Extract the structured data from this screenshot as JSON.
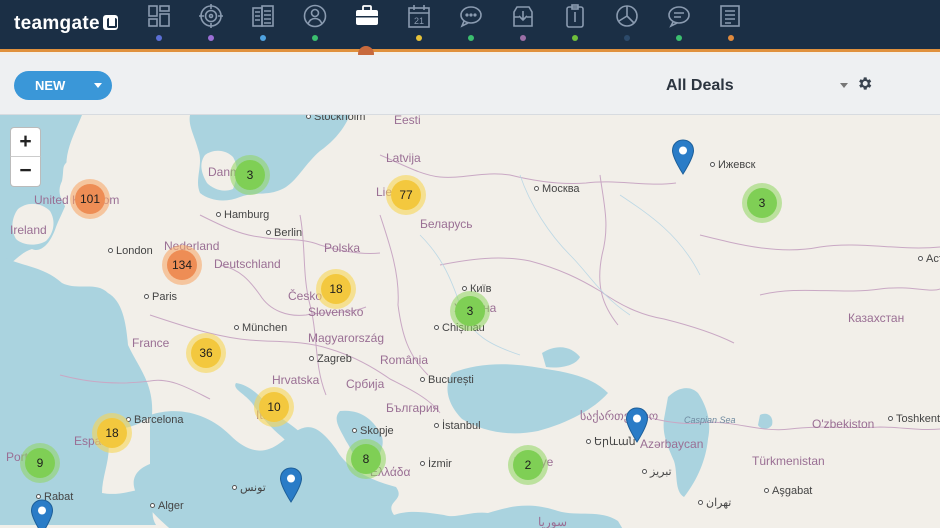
{
  "app": {
    "logo_text": "teamgate"
  },
  "nav": {
    "items": [
      {
        "name": "dashboard",
        "icon": "dashboard-icon",
        "color": "#5b6fd6"
      },
      {
        "name": "goals",
        "icon": "target-icon",
        "color": "#9b6fd6"
      },
      {
        "name": "companies",
        "icon": "companies-icon",
        "color": "#4fa3e0"
      },
      {
        "name": "people",
        "icon": "people-icon",
        "color": "#3bbf6f"
      },
      {
        "name": "deals",
        "icon": "briefcase-icon",
        "color": "#c86a3d",
        "active": true
      },
      {
        "name": "calendar",
        "icon": "calendar-icon",
        "color": "#e6c23a",
        "day": "21"
      },
      {
        "name": "calls",
        "icon": "chat-icon",
        "color": "#3bbf6f"
      },
      {
        "name": "inbox",
        "icon": "inbox-icon",
        "color": "#9b6fa6"
      },
      {
        "name": "notes",
        "icon": "clipboard-icon",
        "color": "#6fbf3b"
      },
      {
        "name": "reports",
        "icon": "pie-chart-icon",
        "color": "#2c4a6a"
      },
      {
        "name": "messages",
        "icon": "message-icon",
        "color": "#3bbf6f"
      },
      {
        "name": "documents",
        "icon": "document-icon",
        "color": "#e08a3d"
      }
    ]
  },
  "toolbar": {
    "new_label": "NEW",
    "view_label": "All Deals"
  },
  "map": {
    "zoom_in": "+",
    "zoom_out": "−",
    "labels": [
      {
        "text": "Stockholm",
        "kind": "city"
      },
      {
        "text": "Eesti",
        "kind": "country"
      },
      {
        "text": "Latvija",
        "kind": "country"
      },
      {
        "text": "Ижевск",
        "kind": "city"
      },
      {
        "text": "Москва",
        "kind": "city"
      },
      {
        "text": "Lietuva",
        "kind": "country"
      },
      {
        "text": "United Kingdom",
        "kind": "country"
      },
      {
        "text": "Ireland",
        "kind": "country"
      },
      {
        "text": "Hamburg",
        "kind": "city"
      },
      {
        "text": "Danmark",
        "kind": "country"
      },
      {
        "text": "Berlin",
        "kind": "city"
      },
      {
        "text": "Беларусь",
        "kind": "country"
      },
      {
        "text": "London",
        "kind": "city"
      },
      {
        "text": "Nederland",
        "kind": "country"
      },
      {
        "text": "Deutschland",
        "kind": "country"
      },
      {
        "text": "Polska",
        "kind": "country"
      },
      {
        "text": "Paris",
        "kind": "city"
      },
      {
        "text": "Česko",
        "kind": "country"
      },
      {
        "text": "Київ",
        "kind": "city"
      },
      {
        "text": "Україна",
        "kind": "country"
      },
      {
        "text": "Slovensko",
        "kind": "country"
      },
      {
        "text": "München",
        "kind": "city"
      },
      {
        "text": "Magyarország",
        "kind": "country"
      },
      {
        "text": "Chișinău",
        "kind": "city"
      },
      {
        "text": "France",
        "kind": "country"
      },
      {
        "text": "Zagreb",
        "kind": "city"
      },
      {
        "text": "România",
        "kind": "country"
      },
      {
        "text": "Hrvatska",
        "kind": "country"
      },
      {
        "text": "Србија",
        "kind": "country"
      },
      {
        "text": "București",
        "kind": "city"
      },
      {
        "text": "Казахстан",
        "kind": "country"
      },
      {
        "text": "Астана",
        "kind": "city"
      },
      {
        "text": "Barcelona",
        "kind": "city"
      },
      {
        "text": "Italia",
        "kind": "country"
      },
      {
        "text": "България",
        "kind": "country"
      },
      {
        "text": "España",
        "kind": "country"
      },
      {
        "text": "Skopje",
        "kind": "city"
      },
      {
        "text": "İstanbul",
        "kind": "city"
      },
      {
        "text": "საქართველო",
        "kind": "country"
      },
      {
        "text": "Caspian Sea",
        "kind": "sea"
      },
      {
        "text": "O'zbekiston",
        "kind": "country"
      },
      {
        "text": "Toshkent",
        "kind": "city"
      },
      {
        "text": "Portugal",
        "kind": "country"
      },
      {
        "text": "Ελλάδα",
        "kind": "country"
      },
      {
        "text": "İzmir",
        "kind": "city"
      },
      {
        "text": "Türkiye",
        "kind": "country"
      },
      {
        "text": "Երևան",
        "kind": "city"
      },
      {
        "text": "Azərbaycan",
        "kind": "country"
      },
      {
        "text": "Türkmenistan",
        "kind": "country"
      },
      {
        "text": "Rabat",
        "kind": "city"
      },
      {
        "text": "تونس",
        "kind": "city"
      },
      {
        "text": "تبریز",
        "kind": "city"
      },
      {
        "text": "Aşgabat",
        "kind": "city"
      },
      {
        "text": "Alger",
        "kind": "city"
      },
      {
        "text": "تهران",
        "kind": "city"
      },
      {
        "text": "سوريا",
        "kind": "country"
      }
    ],
    "clusters": [
      {
        "count": "3",
        "color": "green"
      },
      {
        "count": "101",
        "color": "orange"
      },
      {
        "count": "77",
        "color": "yellow"
      },
      {
        "count": "3",
        "color": "green"
      },
      {
        "count": "134",
        "color": "orange"
      },
      {
        "count": "18",
        "color": "yellow"
      },
      {
        "count": "3",
        "color": "green"
      },
      {
        "count": "36",
        "color": "yellow"
      },
      {
        "count": "10",
        "color": "yellow"
      },
      {
        "count": "18",
        "color": "yellow"
      },
      {
        "count": "9",
        "color": "green"
      },
      {
        "count": "8",
        "color": "green"
      },
      {
        "count": "2",
        "color": "green"
      }
    ],
    "marker_color": "#2a7cc7"
  }
}
